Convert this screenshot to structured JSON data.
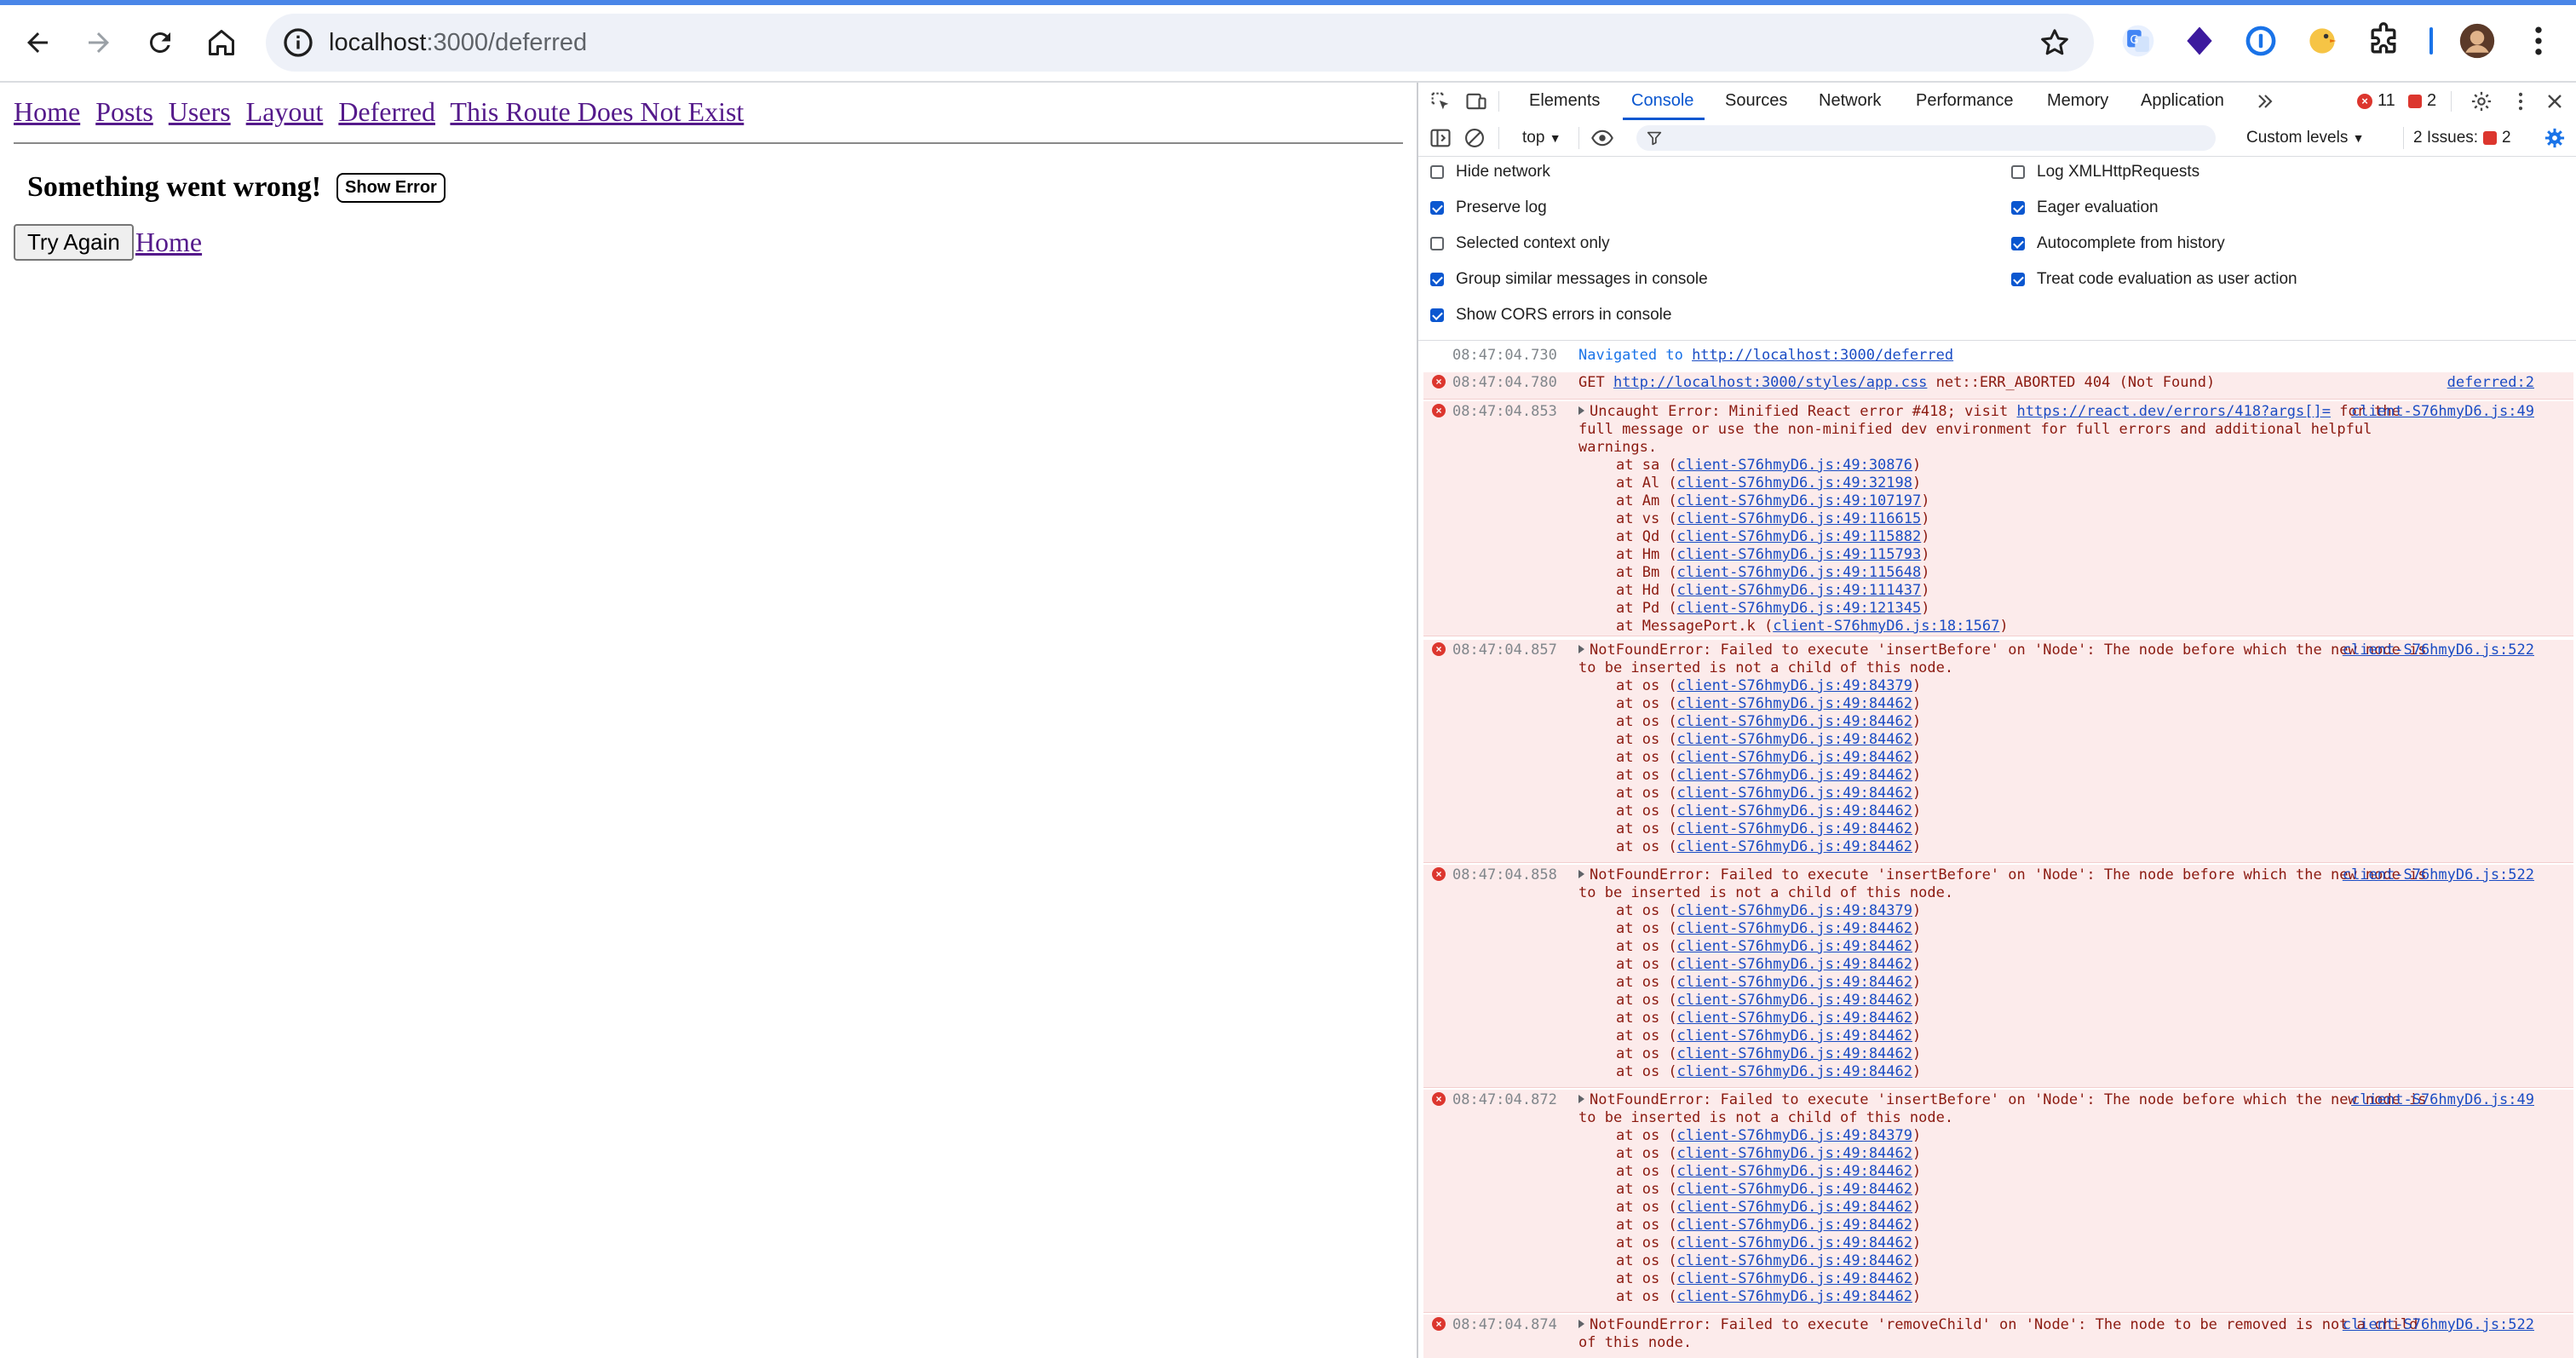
{
  "browser": {
    "url_host": "localhost",
    "url_path": ":3000/deferred"
  },
  "page": {
    "nav_links": [
      "Home",
      "Posts",
      "Users",
      "Layout",
      "Deferred",
      "This Route Does Not Exist"
    ],
    "error_heading": "Something went wrong!",
    "show_error_label": "Show Error",
    "try_again_label": "Try Again",
    "home_link": "Home"
  },
  "devtools": {
    "tabs": [
      "Elements",
      "Console",
      "Sources",
      "Network",
      "Performance",
      "Memory",
      "Application"
    ],
    "active_tab": "Console",
    "error_count": "11",
    "warning_count": "2",
    "context": "top",
    "custom_levels": "Custom levels",
    "issues_label": "2 Issues:",
    "issues_count": "2",
    "settings": {
      "hide_network": {
        "label": "Hide network",
        "checked": false
      },
      "log_xhr": {
        "label": "Log XMLHttpRequests",
        "checked": false
      },
      "preserve_log": {
        "label": "Preserve log",
        "checked": true
      },
      "eager_eval": {
        "label": "Eager evaluation",
        "checked": true
      },
      "selected_context": {
        "label": "Selected context only",
        "checked": false
      },
      "autocomplete": {
        "label": "Autocomplete from history",
        "checked": true
      },
      "group_similar": {
        "label": "Group similar messages in console",
        "checked": true
      },
      "treat_code": {
        "label": "Treat code evaluation as user action",
        "checked": true
      },
      "show_cors": {
        "label": "Show CORS errors in console",
        "checked": true
      }
    },
    "messages": [
      {
        "type": "nav",
        "ts": "08:47:04.730",
        "text": "Navigated to ",
        "link": "http://localhost:3000/deferred"
      },
      {
        "type": "err",
        "ts": "08:47:04.780",
        "prefix": "GET ",
        "link": "http://localhost:3000/styles/app.css",
        "text": " net::ERR_ABORTED 404 (Not Found)",
        "src": "deferred:2"
      },
      {
        "type": "err",
        "ts": "08:47:04.853",
        "text": "Uncaught Error: Minified React error #418; visit",
        "link": "https://react.dev/errors/418?args[]=",
        "text2": " for the full message or use the non-minified dev environment for full errors and additional helpful warnings.",
        "src": "client-S76hmyD6.js:49",
        "stack": [
          [
            "sa",
            "client-S76hmyD6.js:49:30876"
          ],
          [
            "Al",
            "client-S76hmyD6.js:49:32198"
          ],
          [
            "Am",
            "client-S76hmyD6.js:49:107197"
          ],
          [
            "vs",
            "client-S76hmyD6.js:49:116615"
          ],
          [
            "Qd",
            "client-S76hmyD6.js:49:115882"
          ],
          [
            "Hm",
            "client-S76hmyD6.js:49:115793"
          ],
          [
            "Bm",
            "client-S76hmyD6.js:49:115648"
          ],
          [
            "Hd",
            "client-S76hmyD6.js:49:111437"
          ],
          [
            "Pd",
            "client-S76hmyD6.js:49:121345"
          ],
          [
            "MessagePort.k",
            "client-S76hmyD6.js:18:1567"
          ]
        ]
      },
      {
        "type": "err",
        "ts": "08:47:04.857",
        "text": "NotFoundError: Failed to execute 'insertBefore' on 'Node': The node before which the new node is to be inserted is not a child of this node.",
        "src": "client-S76hmyD6.js:522",
        "stack": [
          [
            "os",
            "client-S76hmyD6.js:49:84379"
          ],
          [
            "os",
            "client-S76hmyD6.js:49:84462"
          ],
          [
            "os",
            "client-S76hmyD6.js:49:84462"
          ],
          [
            "os",
            "client-S76hmyD6.js:49:84462"
          ],
          [
            "os",
            "client-S76hmyD6.js:49:84462"
          ],
          [
            "os",
            "client-S76hmyD6.js:49:84462"
          ],
          [
            "os",
            "client-S76hmyD6.js:49:84462"
          ],
          [
            "os",
            "client-S76hmyD6.js:49:84462"
          ],
          [
            "os",
            "client-S76hmyD6.js:49:84462"
          ],
          [
            "os",
            "client-S76hmyD6.js:49:84462"
          ]
        ]
      },
      {
        "type": "err",
        "ts": "08:47:04.858",
        "text": "NotFoundError: Failed to execute 'insertBefore' on 'Node': The node before which the new node is to be inserted is not a child of this node.",
        "src": "client-S76hmyD6.js:522",
        "stack": [
          [
            "os",
            "client-S76hmyD6.js:49:84379"
          ],
          [
            "os",
            "client-S76hmyD6.js:49:84462"
          ],
          [
            "os",
            "client-S76hmyD6.js:49:84462"
          ],
          [
            "os",
            "client-S76hmyD6.js:49:84462"
          ],
          [
            "os",
            "client-S76hmyD6.js:49:84462"
          ],
          [
            "os",
            "client-S76hmyD6.js:49:84462"
          ],
          [
            "os",
            "client-S76hmyD6.js:49:84462"
          ],
          [
            "os",
            "client-S76hmyD6.js:49:84462"
          ],
          [
            "os",
            "client-S76hmyD6.js:49:84462"
          ],
          [
            "os",
            "client-S76hmyD6.js:49:84462"
          ]
        ]
      },
      {
        "type": "err",
        "ts": "08:47:04.872",
        "text": "NotFoundError: Failed to execute 'insertBefore' on 'Node': The node before which the new node is to be inserted is not a child of this node.",
        "src": "client-S76hmyD6.js:49",
        "stack": [
          [
            "os",
            "client-S76hmyD6.js:49:84379"
          ],
          [
            "os",
            "client-S76hmyD6.js:49:84462"
          ],
          [
            "os",
            "client-S76hmyD6.js:49:84462"
          ],
          [
            "os",
            "client-S76hmyD6.js:49:84462"
          ],
          [
            "os",
            "client-S76hmyD6.js:49:84462"
          ],
          [
            "os",
            "client-S76hmyD6.js:49:84462"
          ],
          [
            "os",
            "client-S76hmyD6.js:49:84462"
          ],
          [
            "os",
            "client-S76hmyD6.js:49:84462"
          ],
          [
            "os",
            "client-S76hmyD6.js:49:84462"
          ],
          [
            "os",
            "client-S76hmyD6.js:49:84462"
          ]
        ]
      },
      {
        "type": "err",
        "ts": "08:47:04.874",
        "text": "NotFoundError: Failed to execute 'removeChild' on 'Node': The node to be removed is not a child of this node.",
        "src": "client-S76hmyD6.js:522",
        "stack": []
      }
    ]
  },
  "icons": {
    "back": "arrow-left-icon",
    "forward": "arrow-right-icon",
    "reload": "reload-icon",
    "home": "home-icon",
    "info": "info-icon",
    "star": "star-icon",
    "translate": "google-translate-icon",
    "ext_purple": "diamond-extension-icon",
    "ext_1password": "onepassword-icon",
    "ext_bird": "bird-extension-icon",
    "puzzle": "extensions-puzzle-icon",
    "avatar": "profile-avatar",
    "menu": "kebab-menu-icon"
  }
}
